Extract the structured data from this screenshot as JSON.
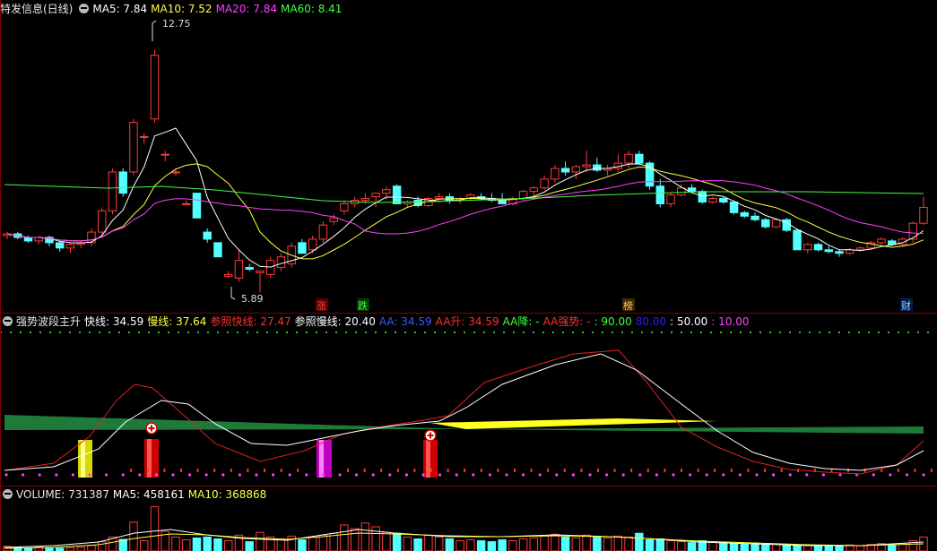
{
  "main_header": {
    "title": "特发信息(日线)",
    "ma5": "MA5: 7.84",
    "ma10": "MA10: 7.52",
    "ma20": "MA20: 7.84",
    "ma60": "MA60: 8.41"
  },
  "price_annotations": {
    "high": "12.75",
    "low": "5.89"
  },
  "event_markers": [
    {
      "label": "涨",
      "color": "#ff4040"
    },
    {
      "label": "跌",
      "color": "#40ff40"
    },
    {
      "label": "榜",
      "color": "#ffcc66"
    },
    {
      "label": "财",
      "color": "#9ecbff"
    }
  ],
  "indicator_header": {
    "title": "强势波段主升",
    "fast": "快线: 34.59",
    "slow": "慢线: 37.64",
    "ref_fast": "参照快线: 27.47",
    "ref_slow": "参照慢线: 20.40",
    "aa": "AA: 34.59",
    "aa_up": "AA升: 34.59",
    "aa_down": "AA降: -",
    "aa_strong": "AA强势: -",
    "l90": ": 90.00",
    "l80": "80.00",
    "l50": ": 50.00",
    "l10": ": 10.00"
  },
  "volume_header": {
    "title": "VOLUME: 731387",
    "ma5": "MA5: 458161",
    "ma10": "MA10: 368868"
  },
  "colors": {
    "up": "#ff3a3a",
    "down": "#54ffff",
    "ma5": "#ffffff",
    "ma10": "#ffff40",
    "ma20": "#ff40ff",
    "ma60": "#40ff40"
  },
  "chart_data": {
    "type": "candlestick",
    "title": "特发信息(日线)",
    "price_high": 12.75,
    "price_low": 5.89,
    "candles": [
      [
        7.5,
        7.6,
        7.4,
        7.55
      ],
      [
        7.55,
        7.6,
        7.4,
        7.45
      ],
      [
        7.45,
        7.5,
        7.3,
        7.35
      ],
      [
        7.35,
        7.5,
        7.25,
        7.45
      ],
      [
        7.45,
        7.5,
        7.2,
        7.3
      ],
      [
        7.3,
        7.35,
        7.05,
        7.15
      ],
      [
        7.15,
        7.3,
        7.0,
        7.25
      ],
      [
        7.25,
        7.35,
        7.15,
        7.3
      ],
      [
        7.3,
        7.7,
        7.2,
        7.6
      ],
      [
        7.6,
        8.3,
        7.5,
        8.2
      ],
      [
        8.2,
        9.4,
        8.1,
        9.3
      ],
      [
        9.3,
        9.4,
        8.6,
        8.7
      ],
      [
        9.3,
        10.8,
        9.2,
        10.7
      ],
      [
        10.3,
        10.4,
        10.1,
        10.3
      ],
      [
        10.8,
        12.75,
        10.7,
        12.6
      ],
      [
        9.8,
        9.9,
        9.6,
        9.8
      ],
      [
        9.3,
        9.4,
        9.2,
        9.3
      ],
      [
        8.4,
        8.5,
        8.4,
        8.4
      ],
      [
        8.7,
        8.7,
        8.0,
        8.0
      ],
      [
        7.6,
        7.7,
        7.3,
        7.4
      ],
      [
        7.3,
        7.3,
        6.9,
        6.9
      ],
      [
        6.35,
        6.5,
        6.3,
        6.4
      ],
      [
        6.3,
        7.1,
        6.2,
        6.8
      ],
      [
        6.6,
        6.7,
        6.5,
        6.55
      ],
      [
        6.45,
        6.5,
        5.89,
        6.5
      ],
      [
        6.4,
        6.9,
        6.3,
        6.8
      ],
      [
        6.6,
        7.0,
        6.5,
        6.9
      ],
      [
        6.7,
        7.3,
        6.6,
        7.2
      ],
      [
        7.3,
        7.4,
        7.0,
        7.0
      ],
      [
        7.1,
        7.5,
        7.0,
        7.4
      ],
      [
        7.4,
        7.9,
        7.3,
        7.8
      ],
      [
        7.9,
        8.1,
        7.8,
        8.0
      ],
      [
        8.2,
        8.5,
        8.1,
        8.4
      ],
      [
        8.4,
        8.6,
        8.3,
        8.5
      ],
      [
        8.5,
        8.7,
        8.4,
        8.55
      ],
      [
        8.6,
        8.7,
        8.3,
        8.7
      ],
      [
        8.7,
        8.9,
        8.5,
        8.8
      ],
      [
        8.9,
        8.95,
        8.4,
        8.4
      ],
      [
        8.4,
        8.5,
        8.3,
        8.45
      ],
      [
        8.5,
        8.6,
        8.3,
        8.35
      ],
      [
        8.35,
        8.6,
        8.3,
        8.55
      ],
      [
        8.55,
        8.7,
        8.5,
        8.6
      ],
      [
        8.6,
        8.7,
        8.4,
        8.5
      ],
      [
        8.5,
        8.6,
        8.4,
        8.55
      ],
      [
        8.55,
        8.7,
        8.5,
        8.65
      ],
      [
        8.6,
        8.7,
        8.5,
        8.55
      ],
      [
        8.55,
        8.7,
        8.45,
        8.5
      ],
      [
        8.5,
        8.7,
        8.4,
        8.4
      ],
      [
        8.4,
        8.6,
        8.35,
        8.55
      ],
      [
        8.55,
        8.8,
        8.5,
        8.75
      ],
      [
        8.75,
        8.9,
        8.6,
        8.85
      ],
      [
        8.85,
        9.2,
        8.8,
        9.1
      ],
      [
        9.1,
        9.5,
        9.0,
        9.4
      ],
      [
        9.4,
        9.6,
        9.2,
        9.3
      ],
      [
        9.3,
        9.5,
        9.1,
        9.45
      ],
      [
        9.45,
        9.9,
        9.3,
        9.5
      ],
      [
        9.5,
        9.7,
        9.3,
        9.35
      ],
      [
        9.35,
        9.5,
        9.2,
        9.4
      ],
      [
        9.4,
        9.8,
        9.3,
        9.55
      ],
      [
        9.55,
        9.9,
        9.4,
        9.8
      ],
      [
        9.8,
        9.9,
        9.5,
        9.55
      ],
      [
        9.55,
        9.6,
        8.8,
        8.9
      ],
      [
        8.9,
        9.1,
        8.3,
        8.4
      ],
      [
        8.4,
        8.7,
        8.3,
        8.65
      ],
      [
        8.65,
        8.95,
        8.6,
        8.85
      ],
      [
        8.85,
        8.95,
        8.7,
        8.75
      ],
      [
        8.75,
        8.8,
        8.4,
        8.45
      ],
      [
        8.45,
        8.6,
        8.4,
        8.55
      ],
      [
        8.55,
        8.6,
        8.4,
        8.45
      ],
      [
        8.45,
        8.5,
        8.1,
        8.15
      ],
      [
        8.15,
        8.2,
        8.0,
        8.05
      ],
      [
        8.05,
        8.15,
        7.9,
        7.95
      ],
      [
        7.95,
        8.0,
        7.7,
        7.75
      ],
      [
        7.75,
        8.0,
        7.7,
        7.95
      ],
      [
        7.95,
        8.0,
        7.6,
        7.65
      ],
      [
        7.65,
        7.7,
        7.1,
        7.1
      ],
      [
        7.1,
        7.3,
        7.0,
        7.25
      ],
      [
        7.25,
        7.3,
        7.05,
        7.1
      ],
      [
        7.1,
        7.2,
        7.0,
        7.05
      ],
      [
        7.05,
        7.1,
        6.9,
        7.0
      ],
      [
        7.0,
        7.15,
        6.95,
        7.1
      ],
      [
        7.1,
        7.2,
        7.05,
        7.15
      ],
      [
        7.15,
        7.35,
        7.1,
        7.3
      ],
      [
        7.3,
        7.45,
        7.2,
        7.4
      ],
      [
        7.35,
        7.4,
        7.2,
        7.25
      ],
      [
        7.25,
        7.45,
        7.2,
        7.4
      ],
      [
        7.4,
        7.9,
        7.3,
        7.85
      ],
      [
        7.85,
        8.6,
        7.8,
        8.3
      ]
    ]
  }
}
